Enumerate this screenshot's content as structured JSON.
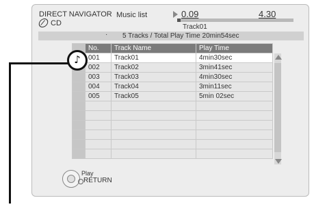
{
  "header": {
    "title": "DIRECT NAVIGATOR",
    "source": "CD",
    "mode": "Music list",
    "elapsed": "0.09",
    "total": "4.30",
    "progress_fraction": 0.03,
    "current_track": "Track01"
  },
  "summary": {
    "dot": "·",
    "text": "5 Tracks / Total Play Time 20min54sec"
  },
  "table": {
    "columns": [
      "No.",
      "Track Name",
      "Play Time"
    ],
    "rows": [
      {
        "no": "001",
        "name": "Track01",
        "time": "4min30sec"
      },
      {
        "no": "002",
        "name": "Track02",
        "time": "3min41sec"
      },
      {
        "no": "003",
        "name": "Track03",
        "time": "4min30sec"
      },
      {
        "no": "004",
        "name": "Track04",
        "time": "3min11sec"
      },
      {
        "no": "005",
        "name": "Track05",
        "time": "5min 02sec"
      }
    ]
  },
  "controls": {
    "play_label": "Play",
    "return_label": "RETURN"
  },
  "callout": {
    "icon": "music-note-icon",
    "glyph": "♪"
  }
}
